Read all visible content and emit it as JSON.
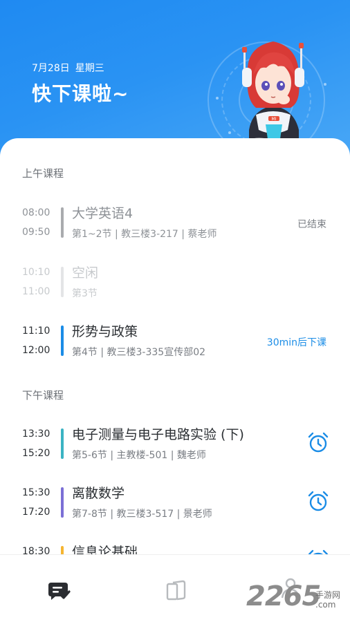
{
  "header": {
    "date": "7月28日",
    "weekday": "星期三",
    "title": "快下课啦~"
  },
  "morning": {
    "section_title": "上午课程",
    "courses": [
      {
        "start": "08:00",
        "end": "09:50",
        "name": "大学英语4",
        "info": "第1~2节 | 教三楼3-217 | 蔡老师",
        "status": "已结束",
        "bar_color": "#a9abae"
      },
      {
        "start": "10:10",
        "end": "11:00",
        "name": "空闲",
        "info": "第3节",
        "bar_color": "#e3e4e6"
      },
      {
        "start": "11:10",
        "end": "12:00",
        "name": "形势与政策",
        "info": "第4节 | 教三楼3-335宣传部02",
        "status": "30min后下课",
        "status_color": "#1a8ce6",
        "bar_color": "#1a8ce6"
      }
    ]
  },
  "afternoon": {
    "section_title": "下午课程",
    "courses": [
      {
        "start": "13:30",
        "end": "15:20",
        "name": "电子测量与电子电路实验 (下)",
        "info": "第5-6节 | 主教楼-501 | 魏老师",
        "bar_color": "#3bb3c3",
        "icon": "alarm-clock-icon"
      },
      {
        "start": "15:30",
        "end": "17:20",
        "name": "离散数学",
        "info": "第7-8节 | 教三楼3-517 | 景老师",
        "bar_color": "#7b6fd6",
        "icon": "alarm-clock-icon"
      },
      {
        "start": "18:30",
        "name": "信息论基础",
        "bar_color": "#f5b531",
        "icon": "alarm-clock-icon"
      }
    ]
  },
  "mascot": {
    "badge": "MI"
  },
  "tabbar": {
    "tabs": [
      {
        "name": "schedule",
        "icon": "chat-check-icon",
        "active": true
      },
      {
        "name": "books",
        "icon": "books-icon",
        "active": false
      },
      {
        "name": "profile",
        "icon": "person-icon",
        "active": false
      }
    ]
  },
  "watermark": {
    "number": "2265",
    "cn": "手游网",
    "com": ".com"
  },
  "colors": {
    "header_blue": "#2a93f3",
    "accent": "#1a8ce6"
  }
}
